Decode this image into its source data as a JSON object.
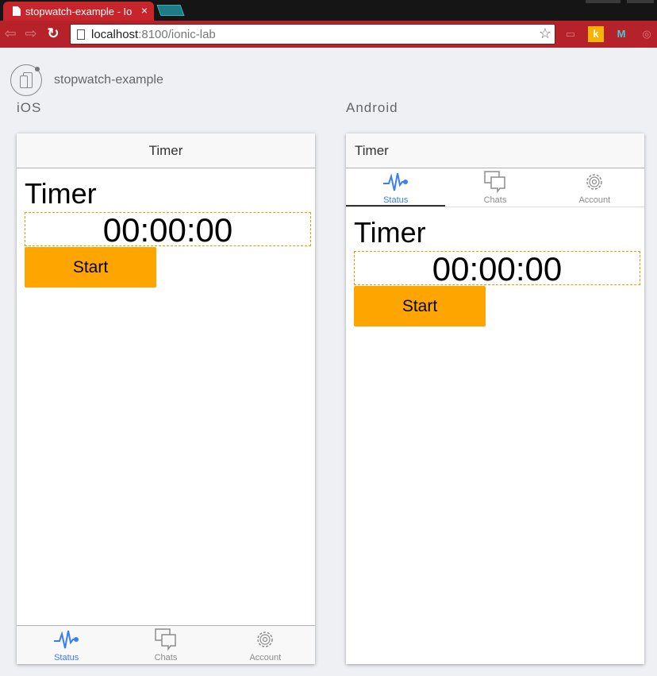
{
  "browser": {
    "tab_title": "stopwatch-example - Io",
    "tab_close": "×",
    "url_host": "localhost",
    "url_rest": ":8100/ionic-lab",
    "star": "☆"
  },
  "lab": {
    "app_name": "stopwatch-example",
    "ios_label": "iOS",
    "android_label": "Android"
  },
  "ios": {
    "nav_title": "Timer",
    "heading": "Timer",
    "clock": "00:00:00",
    "start_label": "Start",
    "tabs": [
      {
        "label": "Status",
        "icon": "pulse-icon",
        "active": true
      },
      {
        "label": "Chats",
        "icon": "chats-icon",
        "active": false
      },
      {
        "label": "Account",
        "icon": "gear-icon",
        "active": false
      }
    ]
  },
  "android": {
    "nav_title": "Timer",
    "heading": "Timer",
    "clock": "00:00:00",
    "start_label": "Start",
    "tabs": [
      {
        "label": "Status",
        "icon": "pulse-icon",
        "active": true
      },
      {
        "label": "Chats",
        "icon": "chats-icon",
        "active": false
      },
      {
        "label": "Account",
        "icon": "gear-icon",
        "active": false
      }
    ]
  },
  "colors": {
    "accent": "#387ef5",
    "button": "#ffa500",
    "chrome_red": "#b5222a"
  }
}
